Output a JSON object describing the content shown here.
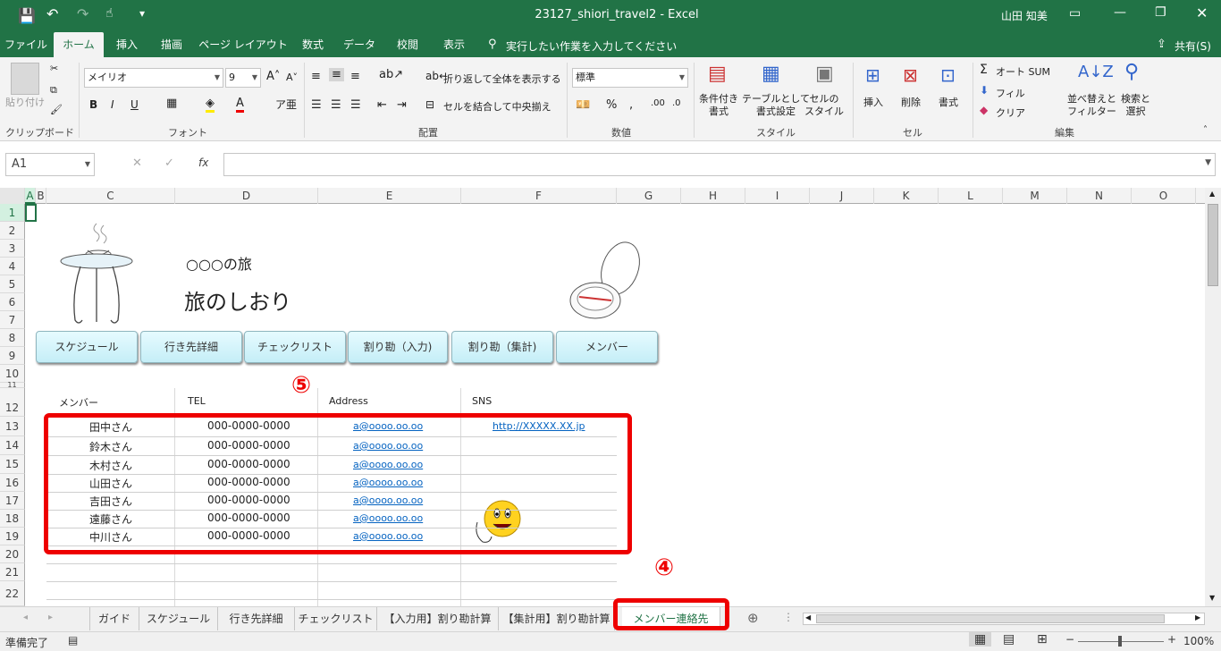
{
  "titlebar": {
    "title": "23127_shiori_travel2 - Excel",
    "user": "山田 知美"
  },
  "ribbon_tabs": [
    "ファイル",
    "ホーム",
    "挿入",
    "描画",
    "ページ レイアウト",
    "数式",
    "データ",
    "校閲",
    "表示"
  ],
  "search_hint": "実行したい作業を入力してください",
  "share": "共有(S)",
  "ribbon": {
    "paste": "貼り付け",
    "clipboard": "クリップボード",
    "font_name": "メイリオ",
    "font_size": "9",
    "font": "フォント",
    "bold": "B",
    "italic": "I",
    "underline": "U",
    "wrap": "折り返して全体を表示する",
    "merge": "セルを結合して中央揃え",
    "alignment": "配置",
    "number_format": "標準",
    "number": "数値",
    "cond_format": "条件付き\n書式",
    "table_format": "テーブルとして\n書式設定",
    "cell_style": "セルの\nスタイル",
    "styles": "スタイル",
    "insert": "挿入",
    "delete": "削除",
    "format": "書式",
    "cells": "セル",
    "autosum": "オート SUM",
    "fill": "フィル",
    "clear": "クリア",
    "sort": "並べ替えと\nフィルター",
    "find": "検索と\n選択",
    "editing": "編集"
  },
  "namebox": "A1",
  "fx": "fx",
  "columns": [
    "A",
    "B",
    "C",
    "D",
    "E",
    "F",
    "G",
    "H",
    "I",
    "J",
    "K",
    "L",
    "M",
    "N",
    "O"
  ],
  "rows": [
    "1",
    "2",
    "3",
    "4",
    "5",
    "6",
    "7",
    "8",
    "9",
    "10",
    "11",
    "12",
    "13",
    "14",
    "15",
    "16",
    "17",
    "18",
    "19",
    "20",
    "21",
    "22"
  ],
  "doc": {
    "subtitle": "○○○の旅",
    "title": "旅のしおり"
  },
  "nav_buttons": [
    "スケジュール",
    "行き先詳細",
    "チェックリスト",
    "割り勘（入力)",
    "割り勘（集計)",
    "メンバー"
  ],
  "table": {
    "headers": [
      "メンバー",
      "TEL",
      "Address",
      "SNS"
    ],
    "rows": [
      {
        "name": "田中さん",
        "tel": "000-0000-0000",
        "addr": "a@oooo.oo.oo",
        "sns": "http://XXXXX.XX.jp"
      },
      {
        "name": "鈴木さん",
        "tel": "000-0000-0000",
        "addr": "a@oooo.oo.oo",
        "sns": ""
      },
      {
        "name": "木村さん",
        "tel": "000-0000-0000",
        "addr": "a@oooo.oo.oo",
        "sns": ""
      },
      {
        "name": "山田さん",
        "tel": "000-0000-0000",
        "addr": "a@oooo.oo.oo",
        "sns": ""
      },
      {
        "name": "吉田さん",
        "tel": "000-0000-0000",
        "addr": "a@oooo.oo.oo",
        "sns": ""
      },
      {
        "name": "遠藤さん",
        "tel": "000-0000-0000",
        "addr": "a@oooo.oo.oo",
        "sns": ""
      },
      {
        "name": "中川さん",
        "tel": "000-0000-0000",
        "addr": "a@oooo.oo.oo",
        "sns": ""
      }
    ]
  },
  "annotations": {
    "five": "⑤",
    "four": "④"
  },
  "sheet_tabs": [
    "ガイド",
    "スケジュール",
    "行き先詳細",
    "チェックリスト",
    "【入力用】割り勘計算",
    "【集計用】割り勘計算",
    "メンバー連絡先"
  ],
  "status": {
    "ready": "準備完了",
    "zoom": "100%"
  }
}
